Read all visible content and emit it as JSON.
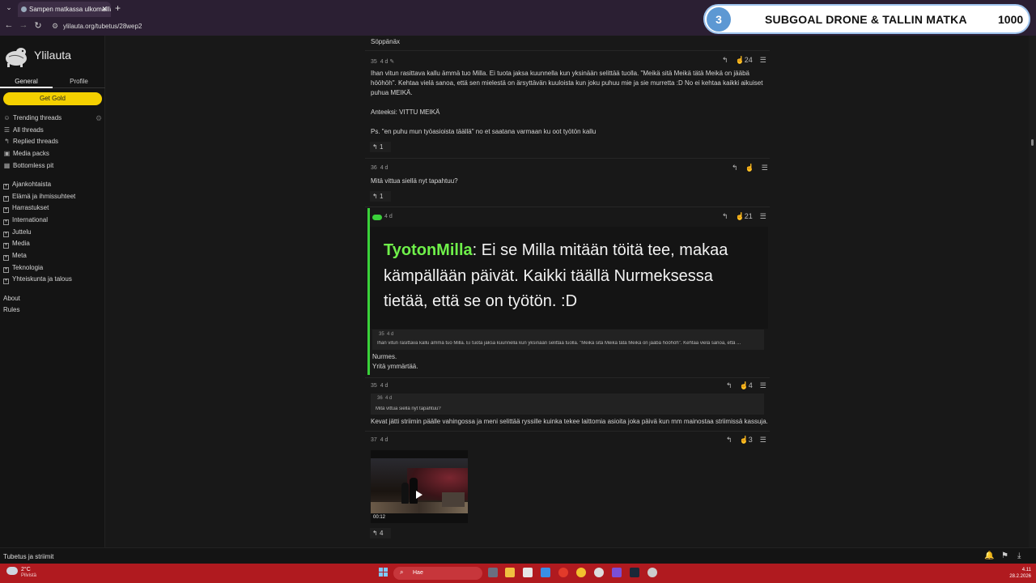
{
  "browser": {
    "tab_title": "Sampen matkassa ulkomailla...",
    "url": "ylilauta.org/tubetus/28wep2"
  },
  "overlay": {
    "number": "3",
    "title": "SUBGOAL DRONE & TALLIN MATKA",
    "count": "1000"
  },
  "sidebar": {
    "site_title": "Ylilauta",
    "tabs": [
      "General",
      "Profile"
    ],
    "gold_label": "Get Gold",
    "nav": [
      "Trending threads",
      "All threads",
      "Replied threads",
      "Media packs",
      "Bottomless pit"
    ],
    "categories": [
      "Ajankohtaista",
      "Elämä ja ihmissuhteet",
      "Harrastukset",
      "International",
      "Juttelu",
      "Media",
      "Meta",
      "Teknologia",
      "Yhteiskunta ja talous"
    ],
    "footer_links": [
      "About",
      "Rules"
    ]
  },
  "posts": {
    "p0": {
      "text": "Söppänäx"
    },
    "p1": {
      "num": "35",
      "age": "4 d",
      "likes": "24",
      "lines": [
        "Ihan vitun rasittava kallu ämmä tuo Milla. Ei tuota jaksa kuunnella kun yksinään selittää tuolla. \"Meikä sitä Meikä tätä Meikä on jääbä",
        "höö­höh\". Kehtaa vielä sanoa, että sen mielestä on ärsyttävän kuuloista kun joku puhuu mie ja sie murretta :D No ei kehtaa kaikki aikuiset",
        "puhua MEIKÄ.",
        "Anteeksi: VITTU MEIKÄ",
        "Ps. \"en puhu mun työasioista täällä\" no et saatana varmaan ku oot työtön kallu"
      ],
      "replies": "1"
    },
    "p2": {
      "num": "36",
      "age": "4 d",
      "text": "Mitä vittua siellä nyt tapahtuu?",
      "replies": "1"
    },
    "p3": {
      "age": "4 d",
      "likes": "21",
      "image_name": "TyotonMilla",
      "image_line1": ": Ei se Milla mitään töitä tee, makaa",
      "image_line2": "kämpällään päivät. Kaikki täällä Nurmeksessa",
      "image_line3": "tietää, että se on työtön. :D",
      "quote_num": "35",
      "quote_age": "4 d",
      "quote_text": "Ihan vitun rasittava kallu ämmä tuo Milla. Ei tuota jaksa kuunnella kun yksinään selittää tuolla. \"Meikä sitä Meikä tätä Meikä on jääbä hööhöh\". Kehtaa vielä sanoa, että ...",
      "line1": "Nurmes.",
      "line2": "Yritä ymmärtää."
    },
    "p4": {
      "num": "35",
      "age": "4 d",
      "likes": "4",
      "quote_num": "36",
      "quote_age": "4 d",
      "quote_text": "Mitä vittua siellä nyt tapahtuu?",
      "text": "Kevat jätti striimin päälle vahingossa ja meni selittää ryssille kuinka tekee laittomia asioita joka päivä kun mm mainostaa striimissä kassuja."
    },
    "p5": {
      "num": "37",
      "age": "4 d",
      "likes": "3",
      "video_duration": "00:12",
      "replies": "4"
    }
  },
  "status": {
    "label": "Tubetus ja striimit"
  },
  "taskbar": {
    "temp": "2°C",
    "weather": "Pilvistä",
    "search_placeholder": "Hae",
    "time": "4.11",
    "date": "28.2.2026"
  },
  "colors": {
    "accent_green": "#3ad13a",
    "gold": "#f4d000",
    "taskbar": "#b01a1f",
    "overlay_circle": "#5d98d3"
  }
}
